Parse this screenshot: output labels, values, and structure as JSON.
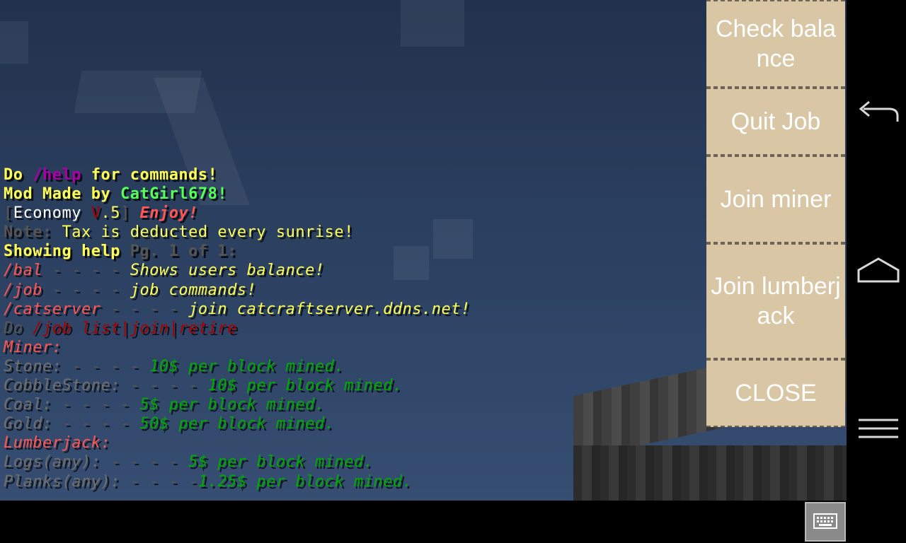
{
  "chat": [
    [
      {
        "t": "Do ",
        "c": "yel",
        "s": "b"
      },
      {
        "t": "/help",
        "c": "pur",
        "s": "b"
      },
      {
        "t": " for commands!",
        "c": "yel",
        "s": "b"
      }
    ],
    [
      {
        "t": "Mod Made by ",
        "c": "yel",
        "s": "b"
      },
      {
        "t": "CatGirl678!",
        "c": "grn",
        "s": "b"
      }
    ],
    [
      {
        "t": "[",
        "c": "gry",
        "s": ""
      },
      {
        "t": "Economy ",
        "c": "wht",
        "s": ""
      },
      {
        "t": "V",
        "c": "dred",
        "s": ""
      },
      {
        "t": ".5",
        "c": "yel",
        "s": ""
      },
      {
        "t": "] ",
        "c": "gry",
        "s": ""
      },
      {
        "t": "Enjoy!",
        "c": "red",
        "s": "b i"
      }
    ],
    [
      {
        "t": "Note: ",
        "c": "gry",
        "s": "b"
      },
      {
        "t": "Tax is deducted every sunrise!",
        "c": "yel",
        "s": ""
      }
    ],
    [
      {
        "t": "Showing help ",
        "c": "yel",
        "s": "b"
      },
      {
        "t": "Pg. 1 of 1:",
        "c": "gry",
        "s": "b"
      }
    ],
    [
      {
        "t": "/bal",
        "c": "red",
        "s": "i"
      },
      {
        "t": " - - - - ",
        "c": "gry",
        "s": ""
      },
      {
        "t": "Shows users balance!",
        "c": "yel",
        "s": "i"
      }
    ],
    [
      {
        "t": "/job",
        "c": "red",
        "s": "i"
      },
      {
        "t": " - - - - ",
        "c": "gry",
        "s": ""
      },
      {
        "t": "job commands!",
        "c": "yel",
        "s": "i"
      }
    ],
    [
      {
        "t": "/catserver",
        "c": "red",
        "s": "i"
      },
      {
        "t": " - - - - ",
        "c": "gry",
        "s": ""
      },
      {
        "t": "join catcraftserver.ddns.net!",
        "c": "yel",
        "s": "i"
      }
    ],
    [
      {
        "t": "Do ",
        "c": "gry",
        "s": "i"
      },
      {
        "t": "/job list|join|retire",
        "c": "dred",
        "s": "i"
      }
    ],
    [
      {
        "t": "Miner:",
        "c": "red",
        "s": "i"
      }
    ],
    [
      {
        "t": "Stone: ",
        "c": "lgry",
        "s": "i"
      },
      {
        "t": "- - - - ",
        "c": "gry",
        "s": ""
      },
      {
        "t": "10$ per block mined.",
        "c": "dgrn",
        "s": "i"
      }
    ],
    [
      {
        "t": "CobbleStone: ",
        "c": "lgry",
        "s": "i"
      },
      {
        "t": "- - - - ",
        "c": "gry",
        "s": ""
      },
      {
        "t": "10$ per block mined.",
        "c": "dgrn",
        "s": "i"
      }
    ],
    [
      {
        "t": "Coal: ",
        "c": "lgry",
        "s": "i"
      },
      {
        "t": "- - - - ",
        "c": "gry",
        "s": ""
      },
      {
        "t": "5$ per block mined.",
        "c": "dgrn",
        "s": "i"
      }
    ],
    [
      {
        "t": "Gold: ",
        "c": "lgry",
        "s": "i"
      },
      {
        "t": "- - - - ",
        "c": "gry",
        "s": ""
      },
      {
        "t": "50$ per block mined.",
        "c": "dgrn",
        "s": "i"
      }
    ],
    [
      {
        "t": "Lumberjack:",
        "c": "red",
        "s": "i"
      }
    ],
    [
      {
        "t": "Logs(any): ",
        "c": "lgry",
        "s": "i"
      },
      {
        "t": "- - - - ",
        "c": "gry",
        "s": ""
      },
      {
        "t": "5$ per block mined.",
        "c": "dgrn",
        "s": "i"
      }
    ],
    [
      {
        "t": "Planks(any): ",
        "c": "lgry",
        "s": "i"
      },
      {
        "t": "- - - -",
        "c": "gry",
        "s": ""
      },
      {
        "t": "1.25$ per block mined.",
        "c": "dgrn",
        "s": "i"
      }
    ]
  ],
  "menu": {
    "check_balance": "Check balance",
    "quit_job": "Quit Job",
    "join_miner": "Join miner",
    "join_lumberjack": "Join lumberjack",
    "close": "CLOSE"
  },
  "nav_icons": [
    "back-icon",
    "home-icon",
    "menu-icon",
    "keyboard-icon"
  ],
  "colors": {
    "button_bg": "#d8c6a4",
    "sky": "#2d4263",
    "yellow": "#ffff55",
    "green": "#55ff55",
    "red": "#ff5555",
    "dark_green": "#00aa00"
  }
}
